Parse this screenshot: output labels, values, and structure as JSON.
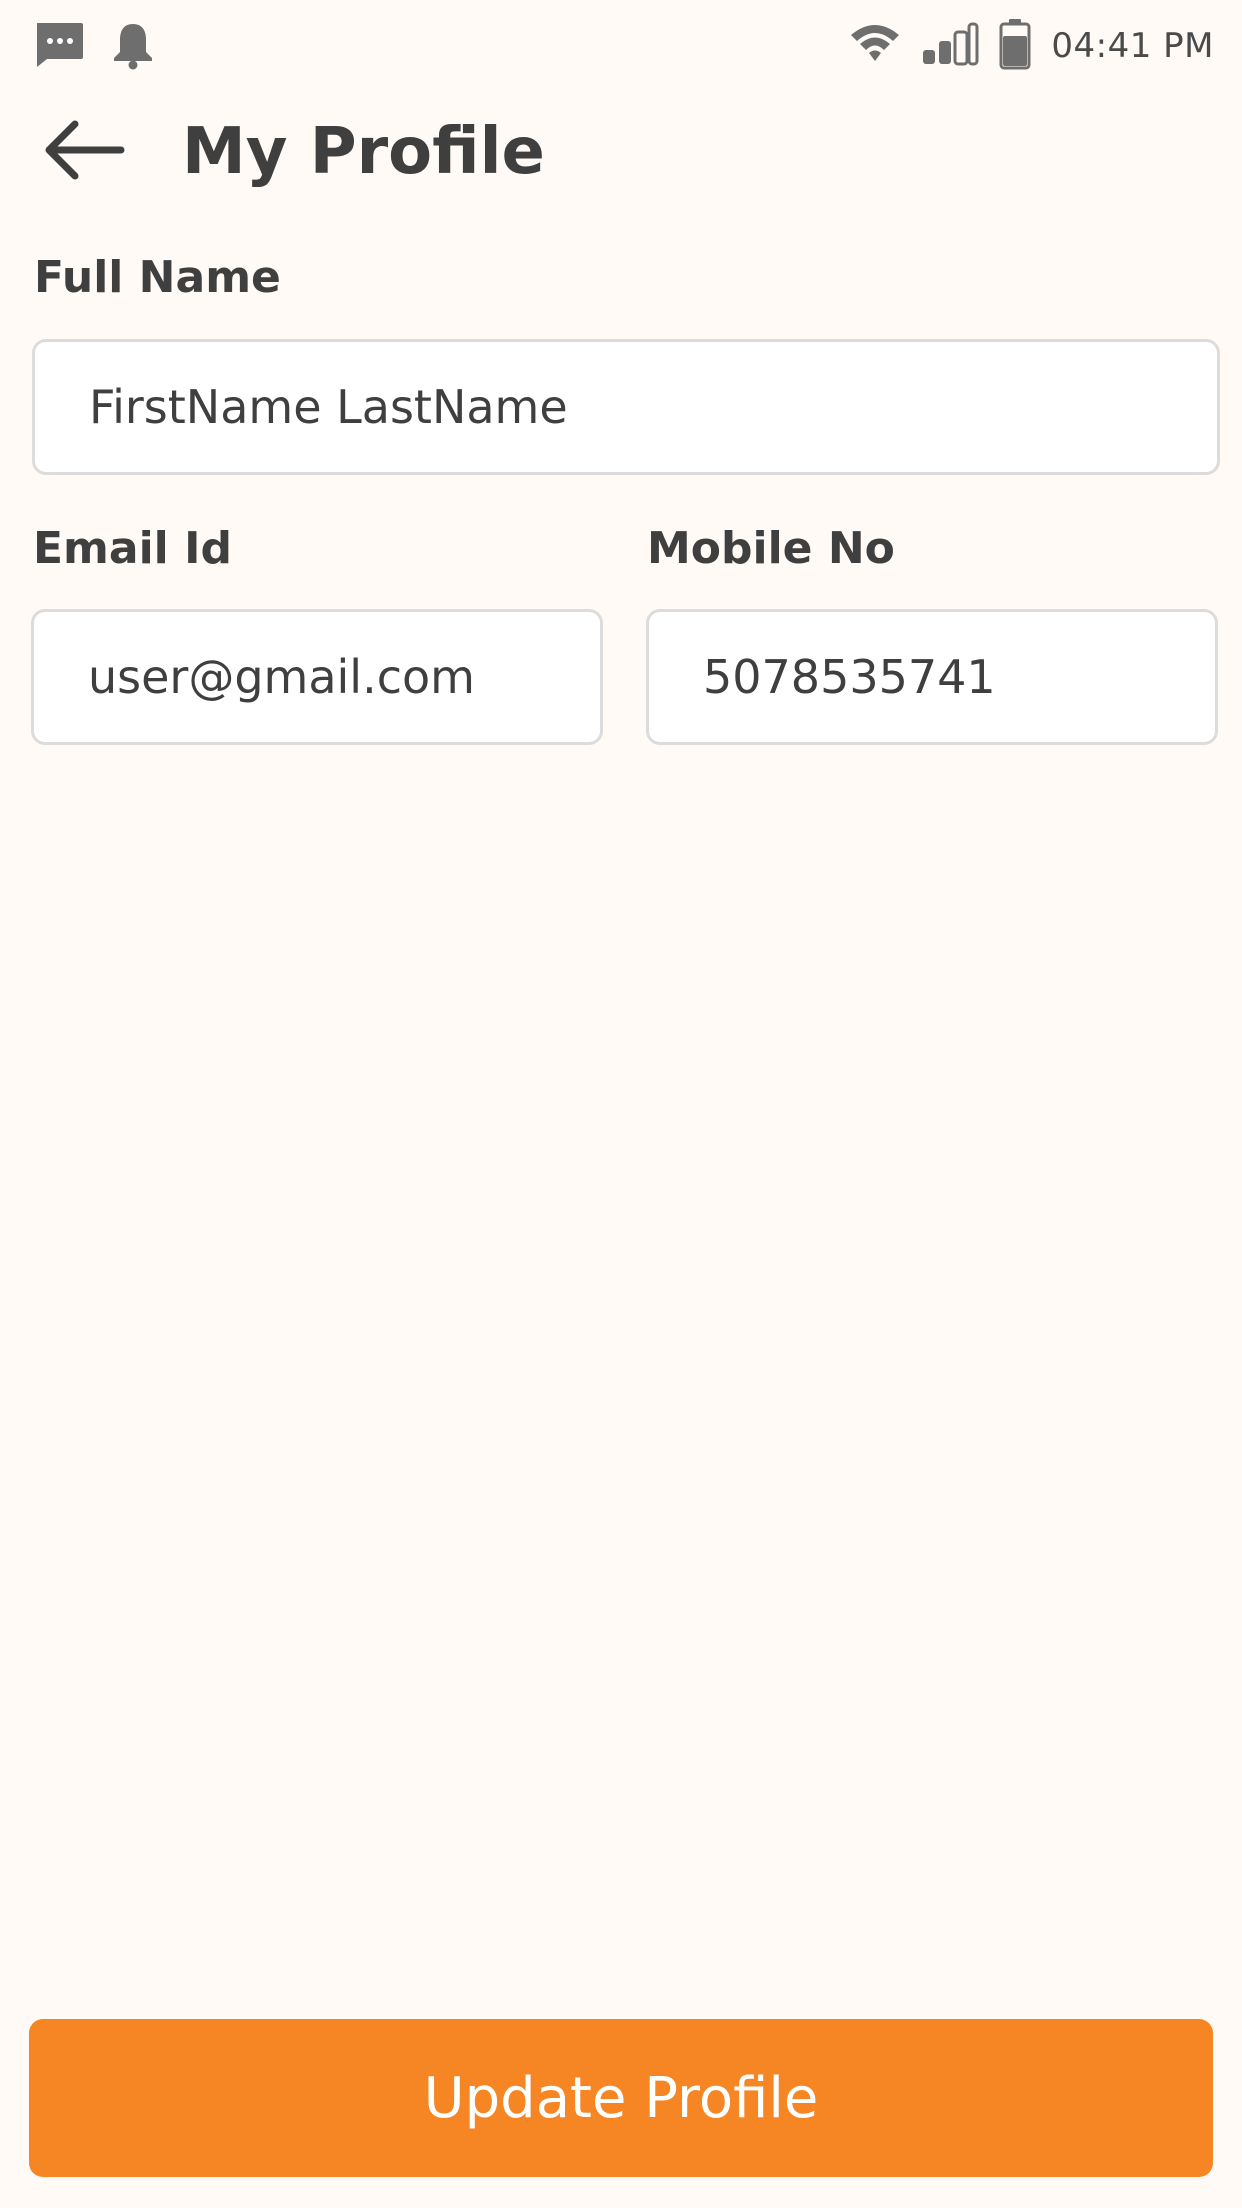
{
  "status_bar": {
    "time": "04:41 PM",
    "left_icons": [
      "message-icon",
      "bell-icon"
    ],
    "right_icons": [
      "wifi-icon",
      "signal-icon",
      "battery-icon"
    ]
  },
  "header": {
    "title": "My Profile",
    "back_icon": "arrow-left-icon"
  },
  "form": {
    "full_name": {
      "label": "Full Name",
      "value": "FirstName LastName"
    },
    "email": {
      "label": "Email Id",
      "value": "user@gmail.com"
    },
    "mobile": {
      "label": "Mobile No",
      "value": "5078535741"
    }
  },
  "actions": {
    "update_label": "Update Profile"
  },
  "colors": {
    "accent": "#f68524",
    "background": "#fffaf5",
    "text": "#3f3f3f",
    "border": "#dcdcdc"
  }
}
